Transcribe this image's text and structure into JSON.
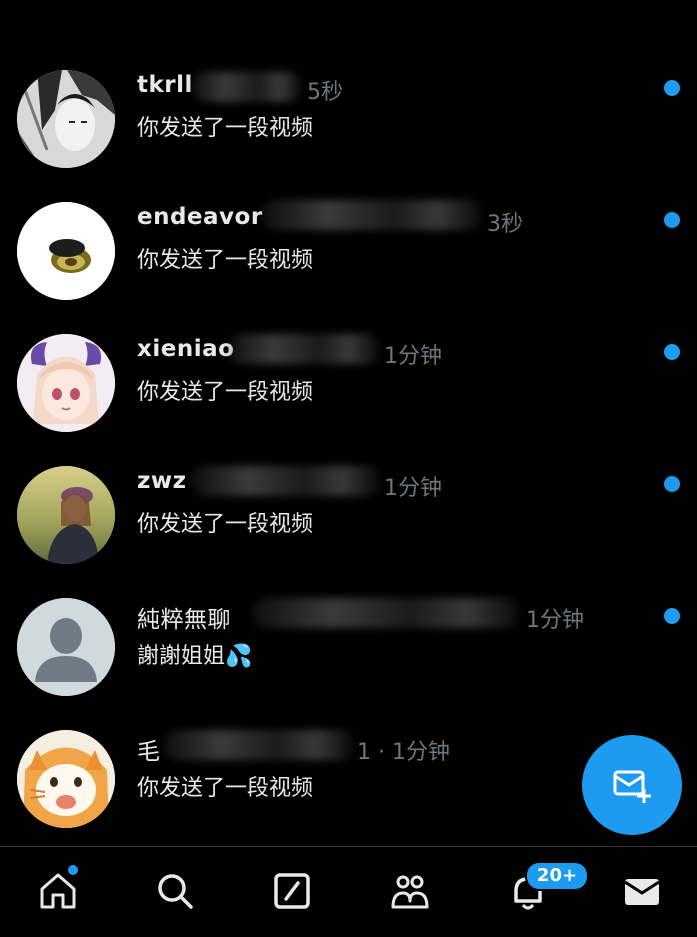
{
  "conversations": [
    {
      "name": "tkrll",
      "time": "5秒",
      "message": "你发送了一段视频",
      "unread": true,
      "avatar_icon": "manga-character-avatar"
    },
    {
      "name": "endeavor",
      "time": "3秒",
      "message": "你发送了一段视频",
      "unread": true,
      "avatar_icon": "avocado-avatar"
    },
    {
      "name": "xieniao",
      "time": "1分钟",
      "message": "你发送了一段视频",
      "unread": true,
      "avatar_icon": "anime-girl-avatar"
    },
    {
      "name": "zwz",
      "time": "1分钟",
      "message": "你发送了一段视频",
      "unread": true,
      "avatar_icon": "photo-person-avatar"
    },
    {
      "name": "純粹無聊",
      "time": "1分钟",
      "message": "謝謝姐姐💦",
      "unread": true,
      "avatar_icon": "default-person-avatar"
    },
    {
      "name": "毛",
      "time": "1 · 1分钟",
      "message": "你发送了一段视频",
      "unread": false,
      "avatar_icon": "cartoon-cat-avatar"
    }
  ],
  "fab": {
    "icon": "new-message-icon"
  },
  "nav": {
    "items": [
      "home-icon",
      "search-icon",
      "grok-icon",
      "communities-icon",
      "notifications-icon",
      "messages-icon"
    ],
    "notifications_badge": "20+"
  },
  "colors": {
    "accent": "#1d9bf0",
    "background": "#000000",
    "muted": "#71767b"
  }
}
